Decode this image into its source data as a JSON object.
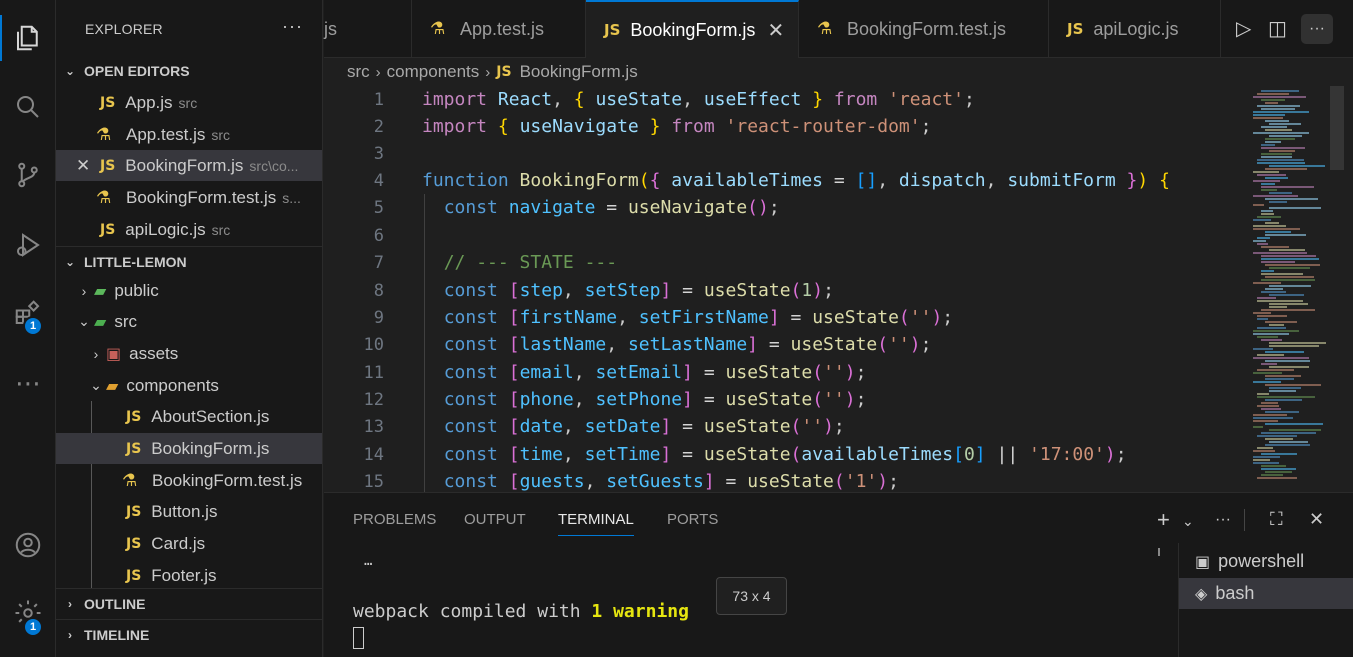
{
  "activity": {
    "icons": [
      "files-icon",
      "search-icon",
      "source-control-icon",
      "run-debug-icon",
      "extensions-icon",
      "more-icon",
      "account-icon",
      "gear-icon"
    ],
    "extensions_badge": "1",
    "settings_badge": "1"
  },
  "sidebar": {
    "title": "EXPLORER",
    "open_editors": {
      "label": "OPEN EDITORS",
      "items": [
        {
          "name": "App.js",
          "desc": "src",
          "kind": "js"
        },
        {
          "name": "App.test.js",
          "desc": "src",
          "kind": "test"
        },
        {
          "name": "BookingForm.js",
          "desc": "src\\co...",
          "kind": "js"
        },
        {
          "name": "BookingForm.test.js",
          "desc": "s...",
          "kind": "test"
        },
        {
          "name": "apiLogic.js",
          "desc": "src",
          "kind": "js"
        }
      ]
    },
    "project": {
      "label": "LITTLE-LEMON",
      "folders": {
        "public": "public",
        "src": "src",
        "assets": "assets",
        "components": "components"
      },
      "files": [
        "AboutSection.js",
        "BookingForm.js",
        "BookingForm.test.js",
        "Button.js",
        "Card.js",
        "Footer.js"
      ]
    },
    "outline": "OUTLINE",
    "timeline": "TIMELINE"
  },
  "tabs": [
    {
      "label": "js",
      "kind": "partial"
    },
    {
      "label": "App.test.js",
      "kind": "test"
    },
    {
      "label": "BookingForm.js",
      "kind": "js"
    },
    {
      "label": "BookingForm.test.js",
      "kind": "test"
    },
    {
      "label": "apiLogic.js",
      "kind": "js"
    }
  ],
  "breadcrumb": {
    "parts": [
      "src",
      "components"
    ],
    "file": "BookingForm.js",
    "file_tag": "JS"
  },
  "js_tag": "JS",
  "editor": {
    "line_numbers": [
      "1",
      "2",
      "3",
      "4",
      "5",
      "6",
      "7",
      "8",
      "9",
      "10",
      "11",
      "12",
      "13",
      "14",
      "15"
    ]
  },
  "panel": {
    "tabs": [
      "PROBLEMS",
      "OUTPUT",
      "TERMINAL",
      "PORTS"
    ],
    "terminal": {
      "ellipsis": "…",
      "compiled_prefix": "webpack compiled with ",
      "warning": "1 warning"
    },
    "terminals": [
      "powershell",
      "bash"
    ],
    "tooltip": "73 x 4"
  }
}
